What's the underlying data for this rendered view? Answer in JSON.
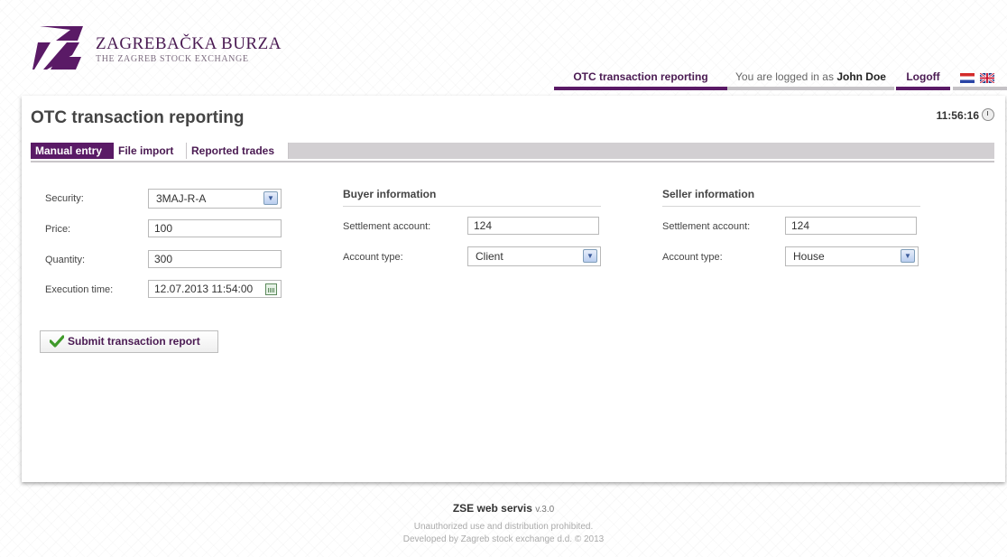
{
  "brand": {
    "name": "ZAGREBAČKA BURZA",
    "subtitle": "THE ZAGREB STOCK EXCHANGE",
    "color": "#5a1a66"
  },
  "topnav": {
    "otc": "OTC transaction reporting",
    "logged_prefix": "You are logged in as ",
    "user": "John Doe",
    "logoff": "Logoff",
    "flags": [
      "croatian-flag-icon",
      "uk-flag-icon"
    ]
  },
  "page": {
    "title": "OTC transaction reporting",
    "time": "11:56:16"
  },
  "tabs": [
    "Manual entry",
    "File import",
    "Reported trades"
  ],
  "form": {
    "security": {
      "label": "Security:",
      "value": "3MAJ-R-A"
    },
    "price": {
      "label": "Price:",
      "value": "100"
    },
    "quantity": {
      "label": "Quantity:",
      "value": "300"
    },
    "execution_time": {
      "label": "Execution time:",
      "value": "12.07.2013 11:54:00"
    }
  },
  "buyer": {
    "heading": "Buyer information",
    "settlement_label": "Settlement account:",
    "settlement_value": "124",
    "type_label": "Account type:",
    "type_value": "Client"
  },
  "seller": {
    "heading": "Seller information",
    "settlement_label": "Settlement account:",
    "settlement_value": "124",
    "type_label": "Account type:",
    "type_value": "House"
  },
  "submit_label": "Submit transaction report",
  "footer": {
    "service": "ZSE web servis",
    "version": "v.3.0",
    "notice": "Unauthorized use and distribution prohibited.",
    "developer": "Developed by Zagreb stock exchange d.d. © 2013"
  }
}
